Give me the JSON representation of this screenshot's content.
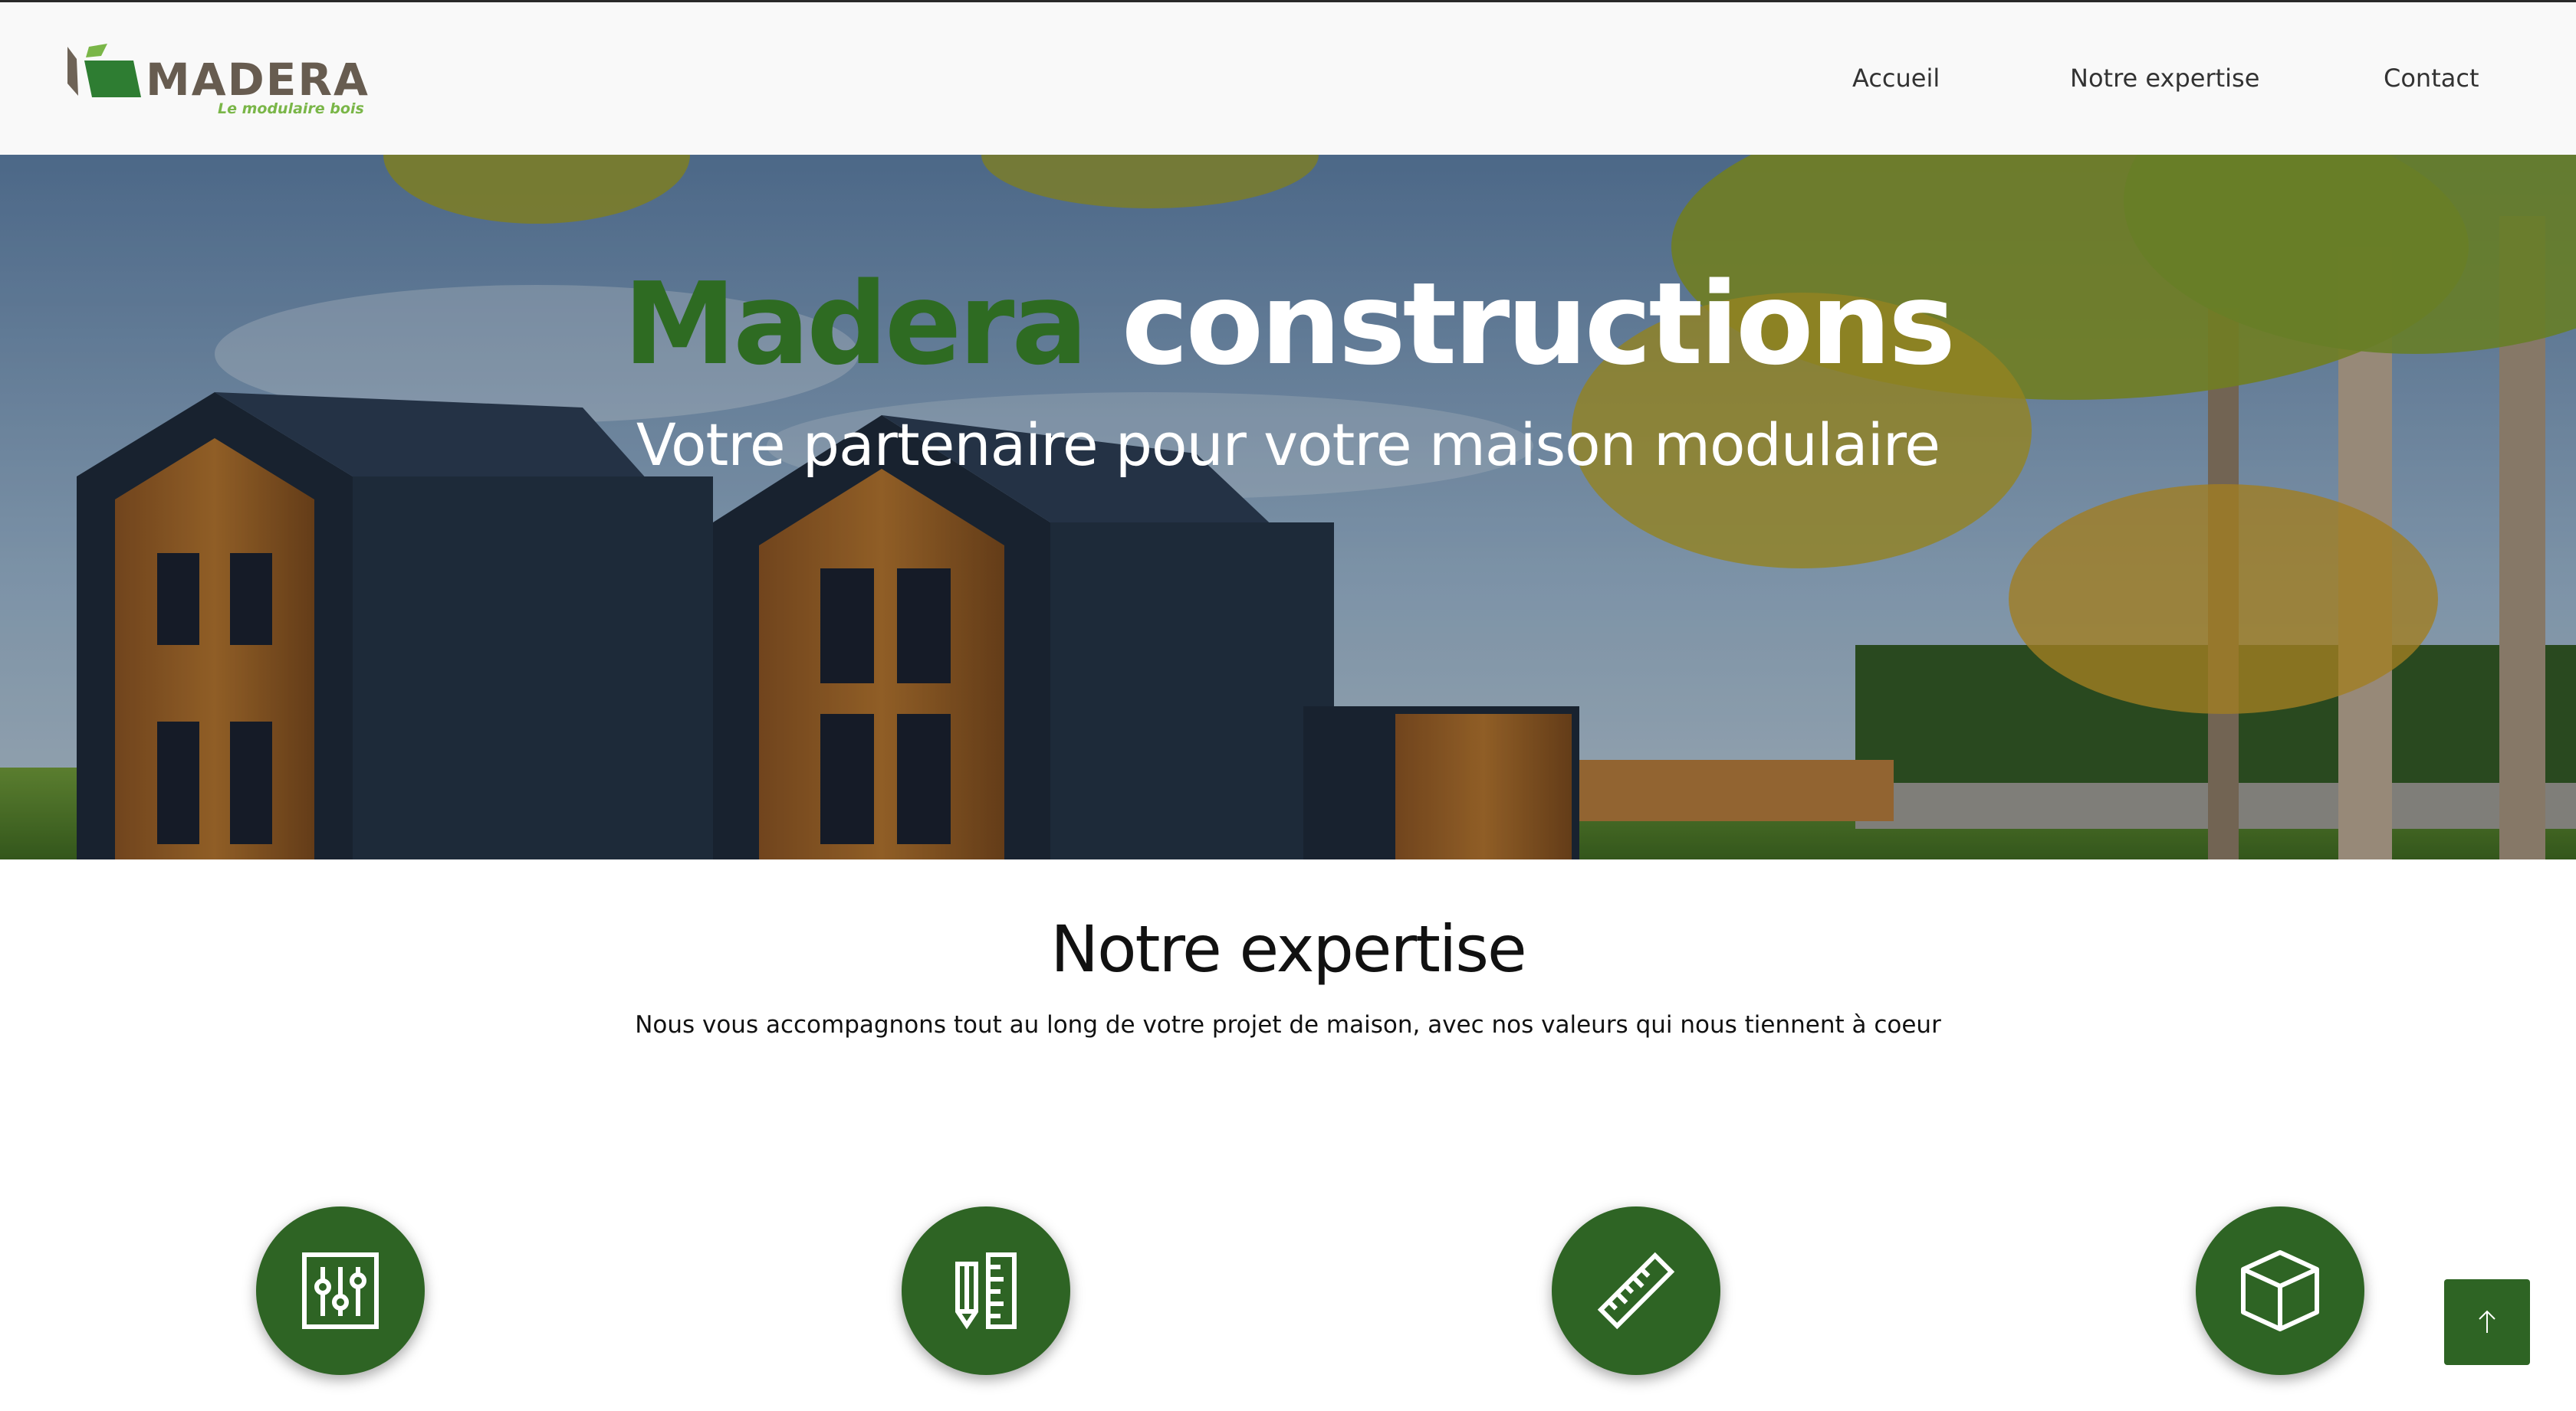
{
  "header": {
    "logo": {
      "word": "MADERA",
      "tagline": "Le modulaire bois"
    },
    "nav": [
      {
        "label": "Accueil"
      },
      {
        "label": "Notre expertise"
      },
      {
        "label": "Contact"
      }
    ]
  },
  "hero": {
    "title_green": "Madera",
    "title_white": "constructions",
    "subtitle": "Votre partenaire pour votre maison modulaire"
  },
  "expertise": {
    "title": "Notre expertise",
    "subtitle": "Nous vous accompagnons tout au long de votre projet de maison, avec nos valeurs qui nous tiennent à coeur",
    "icons": [
      "sliders-icon",
      "pencil-ruler-icon",
      "ruler-icon",
      "box-icon"
    ]
  },
  "scroll_top": {
    "icon": "arrow-up-icon"
  },
  "colors": {
    "brand_green": "#2e6424",
    "title_green": "#2e6b22",
    "tagline_green": "#7ab648",
    "logo_brown": "#675c50"
  }
}
